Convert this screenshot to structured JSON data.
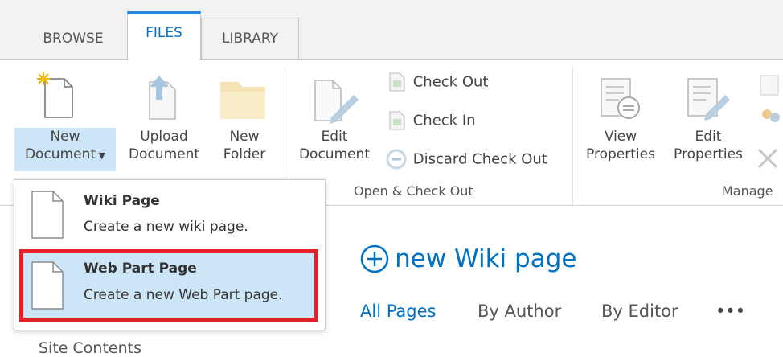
{
  "tabs": [
    "BROWSE",
    "FILES",
    "LIBRARY"
  ],
  "ribbon": {
    "new_document": {
      "line1": "New",
      "line2": "Document"
    },
    "upload_document": {
      "line1": "Upload",
      "line2": "Document"
    },
    "new_folder": {
      "line1": "New",
      "line2": "Folder"
    },
    "edit_document": {
      "line1": "Edit",
      "line2": "Document"
    },
    "check_out": "Check Out",
    "check_in": "Check In",
    "discard_check_out": "Discard Check Out",
    "group_open_check_out": "Open & Check Out",
    "view_properties": {
      "line1": "View",
      "line2": "Properties"
    },
    "edit_properties": {
      "line1": "Edit",
      "line2": "Properties"
    },
    "group_manage": "Manage"
  },
  "dropdown": {
    "items": [
      {
        "title": "Wiki Page",
        "desc": "Create a new wiki page."
      },
      {
        "title": "Web Part Page",
        "desc": "Create a new Web Part page."
      }
    ]
  },
  "page": {
    "new_wiki_label": "new Wiki page",
    "nav_links": [
      "All Pages",
      "By Author",
      "By Editor",
      "•••"
    ],
    "site_contents": "Site Contents"
  },
  "colors": {
    "accent": "#0072c6",
    "selection": "#cde6f7",
    "highlight_border": "#e0232b"
  }
}
